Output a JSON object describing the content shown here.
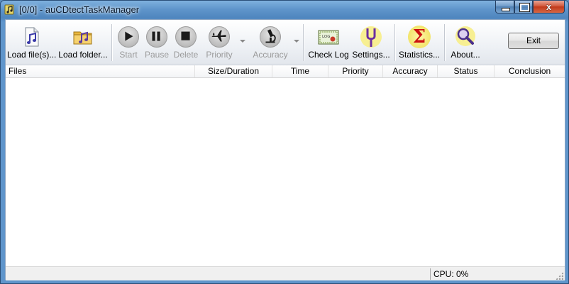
{
  "window": {
    "title": "[0/0] - auCDtectTaskManager",
    "close_glyph": "x"
  },
  "toolbar": {
    "load_files": "Load file(s)...",
    "load_folder": "Load folder...",
    "start": "Start",
    "pause": "Pause",
    "delete": "Delete",
    "priority": "Priority",
    "accuracy": "Accuracy",
    "check_log": "Check Log",
    "settings": "Settings...",
    "statistics": "Statistics...",
    "about": "About...",
    "exit": "Exit",
    "statistics_glyph": "Σ",
    "log_badge": "LOG"
  },
  "icons": {
    "load_files": "music-file-icon",
    "load_folder": "music-folder-icon",
    "start": "play-icon",
    "pause": "pause-icon",
    "delete": "stop-icon",
    "priority": "airplane-icon",
    "accuracy": "microscope-icon",
    "check_log": "certificate-icon",
    "settings": "tuning-fork-icon",
    "statistics": "sigma-icon",
    "about": "magnifier-icon"
  },
  "columns": [
    "Files",
    "Size/Duration",
    "Time",
    "Priority",
    "Accuracy",
    "Status",
    "Conclusion"
  ],
  "statusbar": {
    "cpu": "CPU: 0%"
  },
  "colors": {
    "title_bar": "#5f95cb",
    "close_button": "#c0391b",
    "sigma": "#cc1111",
    "tuning_fork": "#6b2fa0",
    "disabled_text": "#9a9a9a"
  }
}
